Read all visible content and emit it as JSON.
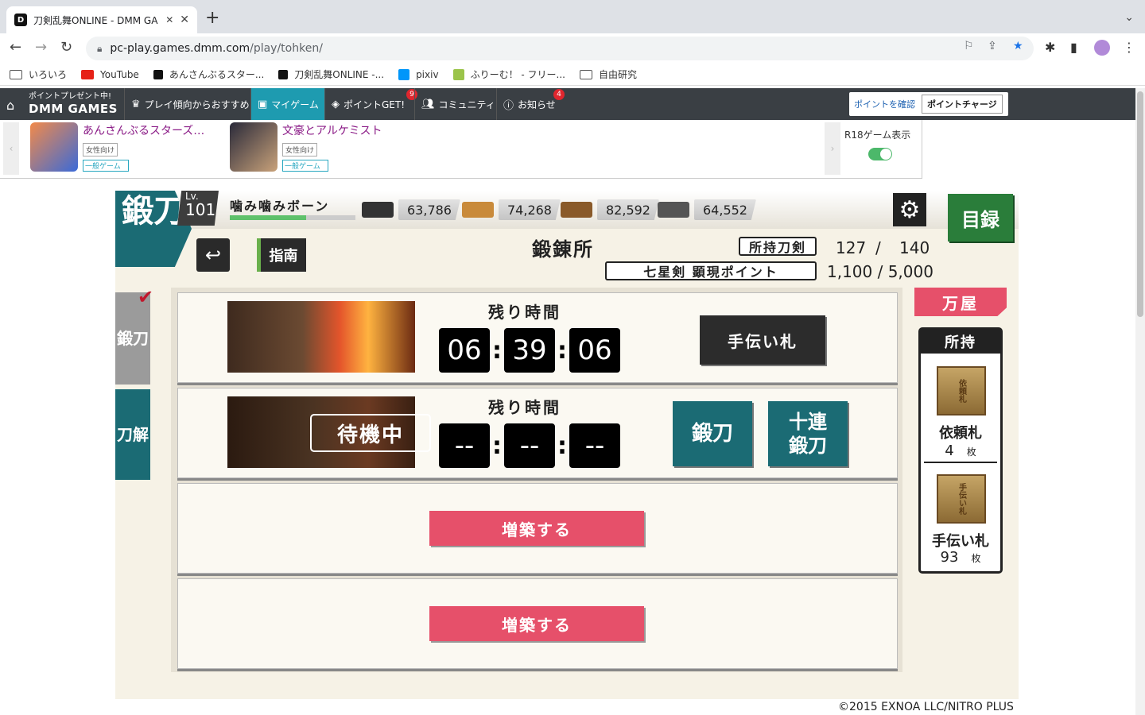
{
  "browser": {
    "tab_title": "刀剣乱舞ONLINE - DMM GA",
    "url_host": "pc-play.games.dmm.com",
    "url_path": "/play/tohken/",
    "bookmarks": [
      "いろいろ",
      "YouTube",
      "あんさんぶるスター...",
      "刀剣乱舞ONLINE -...",
      "pixiv",
      "ふりーむ！ - フリー...",
      "自由研究"
    ]
  },
  "dmm": {
    "promo": "ポイントプレゼント中!",
    "logo": "DMM GAMES",
    "nav": [
      "プレイ傾向からおすすめ",
      "マイゲーム",
      "ポイントGET!",
      "コミュニティ",
      "お知らせ"
    ],
    "badge_points": "9",
    "badge_news": "4",
    "check_points": "ポイントを確認",
    "charge_points": "ポイントチャージ"
  },
  "banner": {
    "games": [
      {
        "title": "あんさんぶるスターズ…",
        "tag": "女性向け",
        "category": "一般ゲーム"
      },
      {
        "title": "文豪とアルケミスト",
        "tag": "女性向け",
        "category": "一般ゲーム"
      }
    ],
    "r18_label": "R18ゲーム表示",
    "r18_on": true
  },
  "game": {
    "section_emblem": "鍛刀",
    "level_label": "Lv.",
    "level": "101",
    "player_name": "噛み噛みボーン",
    "xp_fraction": 0.61,
    "resources": [
      "63,786",
      "74,268",
      "82,592",
      "64,552"
    ],
    "catalog": "目録",
    "guide": "指南",
    "heading": "鍛錬所",
    "owned_label": "所持刀剣",
    "owned_count": "127",
    "owned_sep": "/",
    "owned_max": "140",
    "points_label": "七星剣 顕現ポイント",
    "points_value": "1,100 / 5,000",
    "tabs": [
      "鍛刀",
      "刀解"
    ],
    "slot1": {
      "remain_label": "残り時間",
      "h": "06",
      "m": "39",
      "s": "06",
      "help": "手伝い札"
    },
    "slot2": {
      "status": "待機中",
      "remain_label": "残り時間",
      "h": "--",
      "m": "--",
      "s": "--",
      "forge": "鍛刀",
      "forge10": "十連鍛刀"
    },
    "expand_label": "増築する",
    "shop": "万屋",
    "inventory_title": "所持",
    "items": [
      {
        "name": "依頼札",
        "count": "4",
        "unit": "枚",
        "card_text": "依頼札"
      },
      {
        "name": "手伝い札",
        "count": "93",
        "unit": "枚",
        "card_text": "手伝い札"
      }
    ],
    "copyright": "©2015 EXNOA LLC/NITRO PLUS"
  }
}
